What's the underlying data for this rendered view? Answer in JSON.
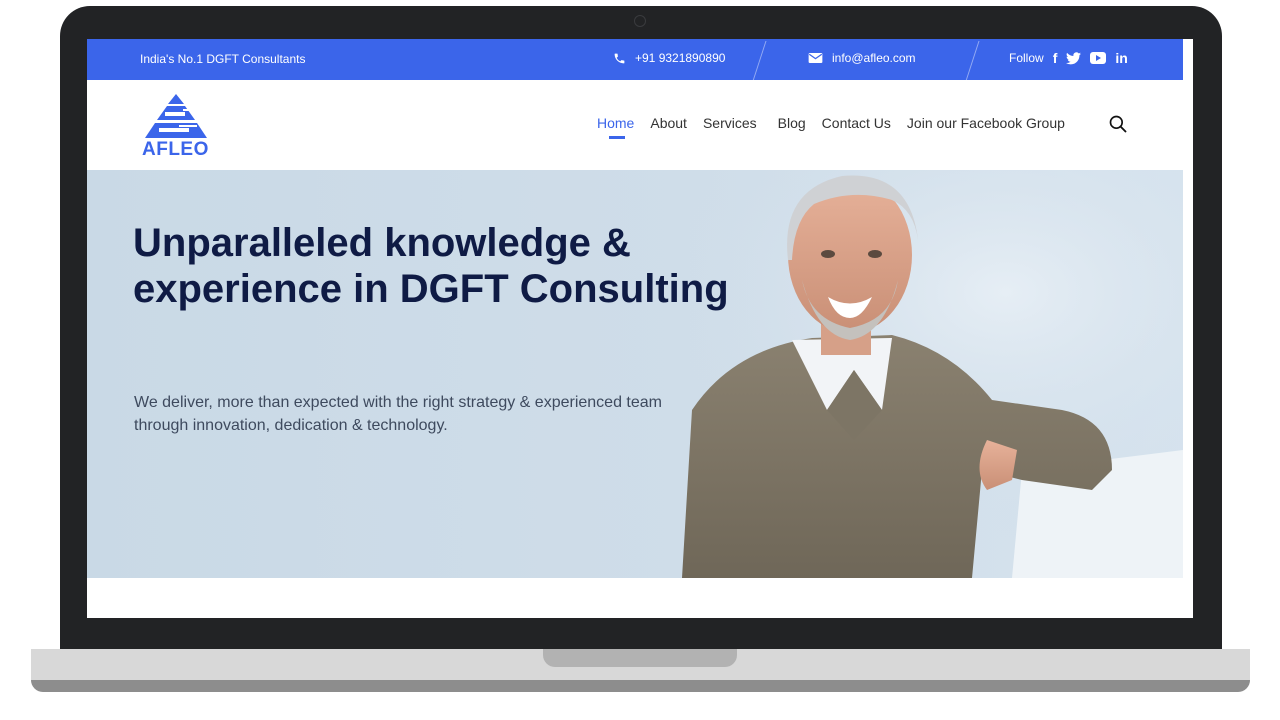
{
  "topbar": {
    "tagline": "India's No.1 DGFT Consultants",
    "phone": "+91 9321890890",
    "email": "info@afleo.com",
    "follow_label": "Follow",
    "social": {
      "facebook": "f",
      "twitter": "🐦",
      "linkedin": "in"
    }
  },
  "header": {
    "logo_text": "AFLEO",
    "nav": [
      "Home",
      "About",
      "Services",
      "Blog",
      "Contact Us",
      "Join our Facebook Group"
    ]
  },
  "hero": {
    "title": "Unparalleled knowledge & experience in DGFT Consulting",
    "subtitle": "We deliver, more than expected with the right strategy & experienced team through innovation, dedication & technology."
  },
  "colors": {
    "brand_blue": "#3b65ea",
    "title_navy": "#0f1b45",
    "laptop_frame": "#222325"
  },
  "icons": [
    "phone-icon",
    "mail-icon",
    "facebook-icon",
    "twitter-icon",
    "youtube-icon",
    "linkedin-icon",
    "search-icon",
    "afleo-logo"
  ]
}
